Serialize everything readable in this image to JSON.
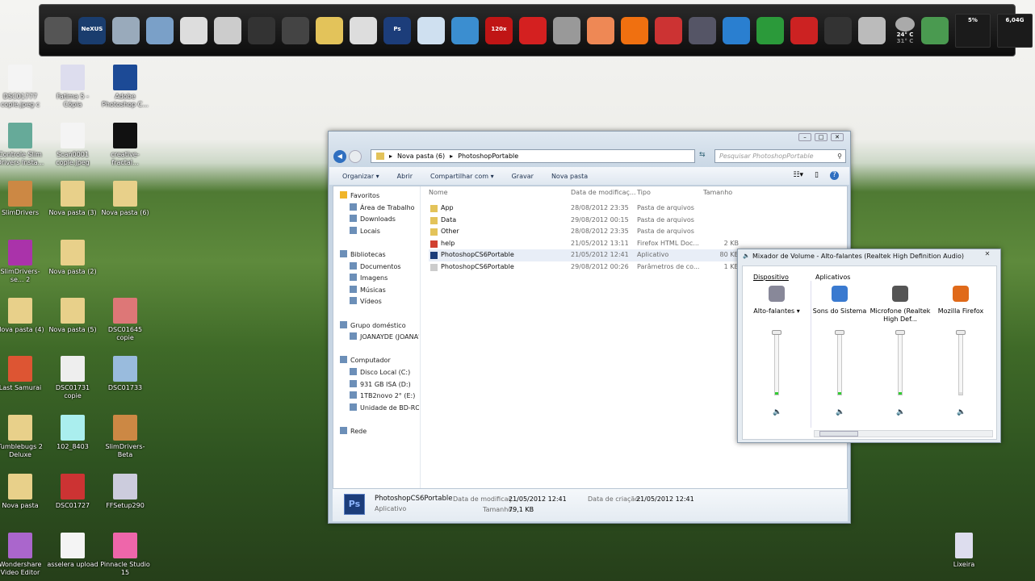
{
  "dock": {
    "items": [
      {
        "name": "tunatic",
        "color": "#555"
      },
      {
        "name": "nexus",
        "label": "NeXUS",
        "color": "#1a3d6e"
      },
      {
        "name": "computer",
        "color": "#9ab"
      },
      {
        "name": "monitor",
        "color": "#7aa0c8"
      },
      {
        "name": "drive",
        "color": "#ddd"
      },
      {
        "name": "drive2",
        "color": "#ccc"
      },
      {
        "name": "printer",
        "color": "#333"
      },
      {
        "name": "device",
        "color": "#444"
      },
      {
        "name": "downloads-folder",
        "color": "#e3c35a"
      },
      {
        "name": "cd",
        "color": "#ddd"
      },
      {
        "name": "photoshop",
        "label": "Ps",
        "color": "#1c3d7a"
      },
      {
        "name": "search",
        "color": "#cfe0f0"
      },
      {
        "name": "app-blue",
        "color": "#3b8ed0"
      },
      {
        "name": "120x",
        "label": "120x",
        "color": "#c01515"
      },
      {
        "name": "red-app",
        "color": "#d42020"
      },
      {
        "name": "camera",
        "color": "#999"
      },
      {
        "name": "picasa",
        "color": "#e85"
      },
      {
        "name": "avast",
        "color": "#f07010"
      },
      {
        "name": "tool",
        "color": "#c33"
      },
      {
        "name": "globe",
        "color": "#556"
      },
      {
        "name": "ie",
        "color": "#2a7fd0"
      },
      {
        "name": "windows",
        "color": "#2b9a3a"
      },
      {
        "name": "photoscape",
        "color": "#c22"
      },
      {
        "name": "clock",
        "color": "#333"
      },
      {
        "name": "trash",
        "color": "#bbb"
      }
    ],
    "weather": "24° C",
    "weather_sub": "31° C",
    "cpu": "5%",
    "memory": "6,04G"
  },
  "desktop": [
    {
      "label": "DSC01777 copie.jpeg c",
      "color": "#f4f4f4"
    },
    {
      "label": "Fatima 5 - Cópia",
      "color": "#dde"
    },
    {
      "label": "Adobe Photoshop C...",
      "color": "#1c4a96"
    },
    {
      "label": "Controle Slim Drivers Insta...",
      "color": "#6a9"
    },
    {
      "label": "Scan0001 copie.jpeg",
      "color": "#f4f4f4"
    },
    {
      "label": "creative-fractal...",
      "color": "#111"
    },
    {
      "label": "SlimDrivers",
      "color": "#c84"
    },
    {
      "label": "Nova pasta (3)",
      "color": "#e8d08a"
    },
    {
      "label": "Nova pasta (6)",
      "color": "#e8d08a"
    },
    {
      "label": "SlimDrivers-se... 2",
      "color": "#a3a"
    },
    {
      "label": "Nova pasta (2)",
      "color": "#e8d08a"
    },
    {
      "label": "",
      "color": ""
    },
    {
      "label": "Nova pasta (4)",
      "color": "#e8d08a"
    },
    {
      "label": "Nova pasta (5)",
      "color": "#e8d08a"
    },
    {
      "label": "DSC01645 copie",
      "color": "#d77"
    },
    {
      "label": "Last Samurai",
      "color": "#d53"
    },
    {
      "label": "DSC01731 copie",
      "color": "#eee"
    },
    {
      "label": "DSC01733",
      "color": "#9bd"
    },
    {
      "label": "Tumblebugs 2 Deluxe",
      "color": "#e8d08a"
    },
    {
      "label": "102_8403",
      "color": "#aee"
    },
    {
      "label": "SlimDrivers-Beta",
      "color": "#c84"
    },
    {
      "label": "Nova pasta",
      "color": "#e8d08a"
    },
    {
      "label": "DSC01727",
      "color": "#c33"
    },
    {
      "label": "FFSetup290",
      "color": "#ccd"
    },
    {
      "label": "Wondershare Video Editor",
      "color": "#a6c"
    },
    {
      "label": "asselera upload",
      "color": "#f4f4f4"
    },
    {
      "label": "Pinnacle Studio 15",
      "color": "#e6a"
    }
  ],
  "recycle": "Lixeira",
  "explorer": {
    "breadcrumb": [
      "Nova pasta (6)",
      "PhotoshopPortable"
    ],
    "search_placeholder": "Pesquisar PhotoshopPortable",
    "toolbar": [
      "Organizar ▾",
      "Abrir",
      "Compartilhar com ▾",
      "Gravar",
      "Nova pasta"
    ],
    "nav": [
      {
        "label": "Favoritos",
        "indent": 0,
        "icon": "star-icon"
      },
      {
        "label": "Área de Trabalho",
        "indent": 1
      },
      {
        "label": "Downloads",
        "indent": 1
      },
      {
        "label": "Locais",
        "indent": 1
      },
      {
        "label": "",
        "indent": 0
      },
      {
        "label": "Bibliotecas",
        "indent": 0
      },
      {
        "label": "Documentos",
        "indent": 1
      },
      {
        "label": "Imagens",
        "indent": 1
      },
      {
        "label": "Músicas",
        "indent": 1
      },
      {
        "label": "Vídeos",
        "indent": 1
      },
      {
        "label": "",
        "indent": 0
      },
      {
        "label": "Grupo doméstico",
        "indent": 0
      },
      {
        "label": "JOANAYDE (JOANA'",
        "indent": 1
      },
      {
        "label": "",
        "indent": 0
      },
      {
        "label": "Computador",
        "indent": 0
      },
      {
        "label": "Disco Local (C:)",
        "indent": 1
      },
      {
        "label": "931 GB  ISA (D:)",
        "indent": 1
      },
      {
        "label": "1TB2novo 2° (E:)",
        "indent": 1
      },
      {
        "label": "Unidade de BD-ROM",
        "indent": 1
      },
      {
        "label": "",
        "indent": 0
      },
      {
        "label": "Rede",
        "indent": 0
      }
    ],
    "columns": [
      "Nome",
      "Data de modificaç...",
      "Tipo",
      "Tamanho"
    ],
    "files": [
      {
        "name": "App",
        "date": "28/08/2012 23:35",
        "type": "Pasta de arquivos",
        "size": "",
        "icon": "folder"
      },
      {
        "name": "Data",
        "date": "29/08/2012 00:15",
        "type": "Pasta de arquivos",
        "size": "",
        "icon": "folder"
      },
      {
        "name": "Other",
        "date": "28/08/2012 23:35",
        "type": "Pasta de arquivos",
        "size": "",
        "icon": "folder"
      },
      {
        "name": "help",
        "date": "21/05/2012 13:11",
        "type": "Firefox HTML Doc...",
        "size": "2 KB",
        "icon": "html"
      },
      {
        "name": "PhotoshopCS6Portable",
        "date": "21/05/2012 12:41",
        "type": "Aplicativo",
        "size": "80 KB",
        "icon": "ps"
      },
      {
        "name": "PhotoshopCS6Portable",
        "date": "29/08/2012 00:26",
        "type": "Parâmetros de co...",
        "size": "1 KB",
        "icon": "ini"
      }
    ],
    "details": {
      "name": "PhotoshopCS6Portable",
      "type": "Aplicativo",
      "mod_label": "Data de modificaç...",
      "mod_value": "21/05/2012 12:41",
      "size_label": "Tamanho:",
      "size_value": "79,1 KB",
      "created_label": "Data de criação:",
      "created_value": "21/05/2012 12:41"
    }
  },
  "mixer": {
    "title": "Mixador de Volume - Alto-falantes (Realtek High Definition Audio)",
    "device_label": "Dispositivo",
    "apps_label": "Aplicativos",
    "channels": [
      {
        "name": "Alto-falantes ▾",
        "level": 1.0,
        "color": "#889"
      },
      {
        "name": "Sons do Sistema",
        "level": 1.0,
        "color": "#3a7ad0"
      },
      {
        "name": "Microfone (Realtek High Def...",
        "level": 1.0,
        "color": "#555"
      },
      {
        "name": "Mozilla Firefox",
        "level": 1.0,
        "color": "#e06a1a"
      }
    ]
  }
}
